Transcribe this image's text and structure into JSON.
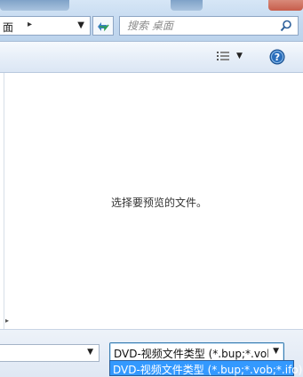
{
  "address_bar": {
    "breadcrumb": "面",
    "breadcrumb_separator": "▸",
    "dropdown_icon": "chevron-down-icon",
    "refresh_icon": "refresh-icon"
  },
  "search": {
    "placeholder": "搜索 桌面",
    "icon": "search-icon"
  },
  "toolbar": {
    "view_icon": "view-menu-icon",
    "view_dropdown_icon": "chevron-down-icon",
    "help_icon": "help-icon"
  },
  "preview_pane": {
    "message": "选择要预览的文件。"
  },
  "file_type": {
    "selected": "DVD-视频文件类型 (*.bup;*.vob;*.ifo)",
    "options": [
      "DVD-视频文件类型 (*.bup;*.vob;*.ifo)"
    ]
  },
  "colors": {
    "selection_highlight": "#3399ff",
    "toolbar_blue": "#dbe6f4",
    "help_icon_blue": "#2a6ebc"
  }
}
